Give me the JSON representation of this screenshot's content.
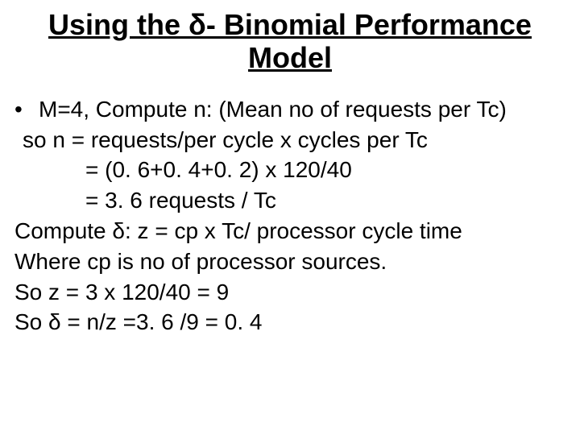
{
  "title": "Using the δ- Binomial Performance Model",
  "bullet": {
    "marker": "•",
    "text": "M=4, Compute n: (Mean no of requests per Tc)"
  },
  "lines": {
    "l1": "so n = requests/per cycle x cycles per Tc",
    "l2": "= (0. 6+0. 4+0. 2) x 120/40",
    "l3": "= 3. 6 requests / Tc",
    "l4": "Compute δ: z = cp x Tc/ processor cycle time",
    "l5": "Where cp is no of processor sources.",
    "l6": "So z = 3 x 120/40 = 9",
    "l7": "So δ = n/z =3. 6 /9 = 0. 4"
  }
}
